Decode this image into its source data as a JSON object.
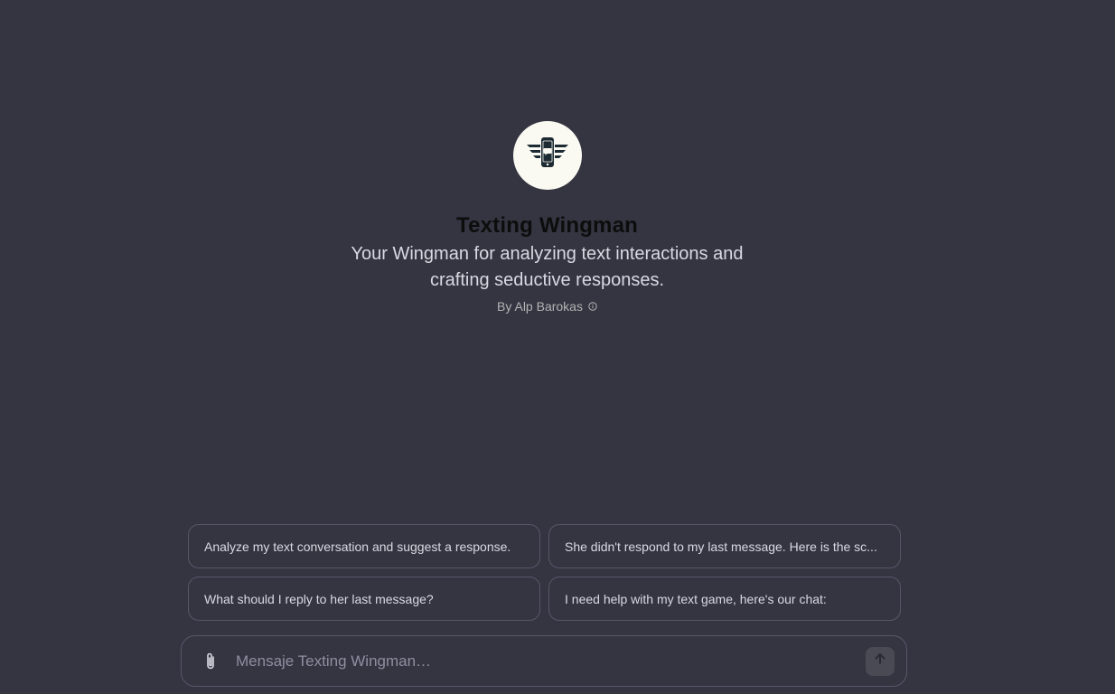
{
  "gpt": {
    "title": "Texting Wingman",
    "description": "Your Wingman for analyzing text interactions and crafting seductive responses.",
    "author": "By Alp Barokas",
    "logo_icon": "phone-with-wings-icon"
  },
  "prompts": [
    {
      "label": "Analyze my text conversation and suggest a response."
    },
    {
      "label": "She didn't respond to my last message. Here is the sc..."
    },
    {
      "label": "What should I reply to her last message?"
    },
    {
      "label": "I need help with my text game, here's our chat:"
    }
  ],
  "composer": {
    "placeholder": "Mensaje Texting Wingman…",
    "attach_icon": "paperclip-icon",
    "send_icon": "arrow-up-icon"
  },
  "colors": {
    "background": "#343541",
    "avatar_bg": "#fbfaf2",
    "border": "#565869"
  }
}
